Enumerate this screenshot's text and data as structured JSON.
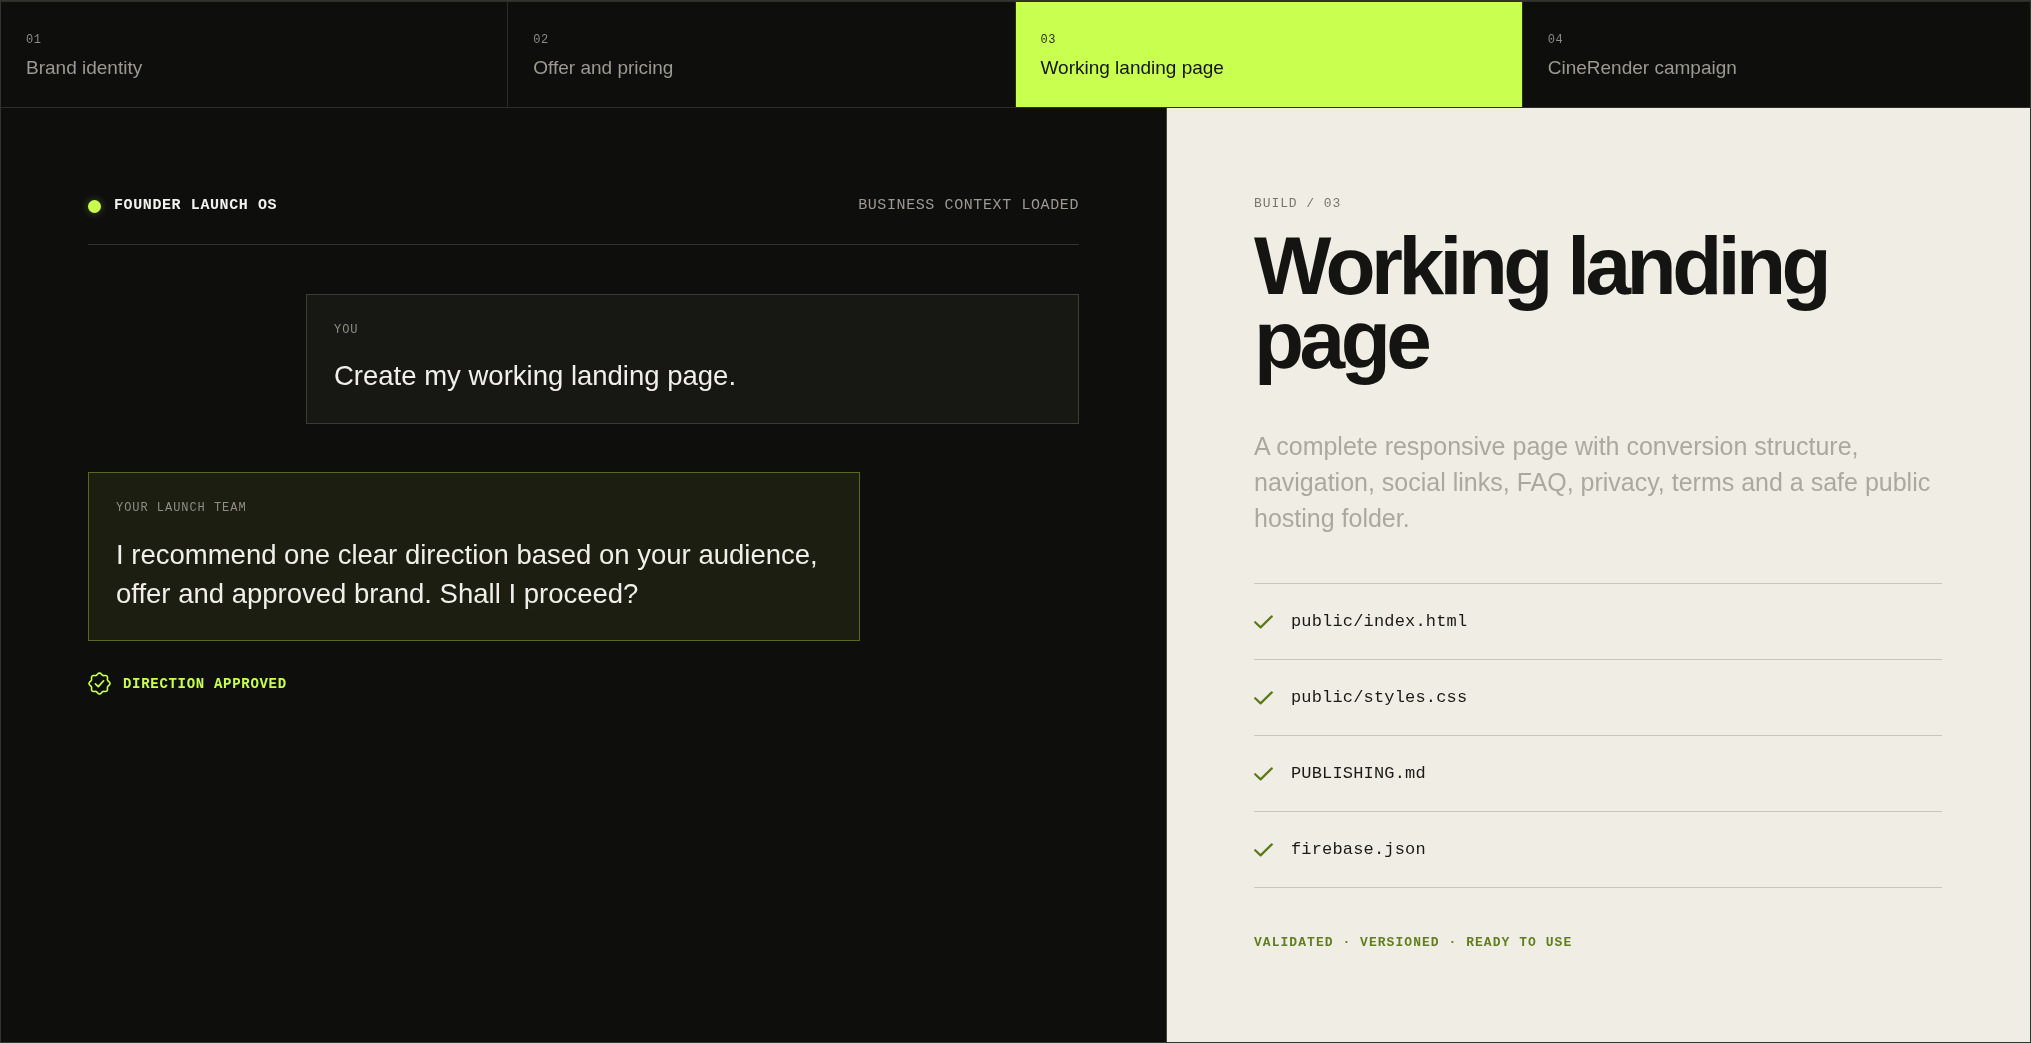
{
  "tabs": [
    {
      "number": "01",
      "label": "Brand identity",
      "selected": false
    },
    {
      "number": "02",
      "label": "Offer and pricing",
      "selected": false
    },
    {
      "number": "03",
      "label": "Working landing page",
      "selected": true
    },
    {
      "number": "04",
      "label": "CineRender campaign",
      "selected": false
    }
  ],
  "chat_panel": {
    "header": {
      "title": "FOUNDER LAUNCH OS",
      "status": "BUSINESS CONTEXT LOADED"
    },
    "messages": [
      {
        "kind": "user",
        "sender": "YOU",
        "text": "Create my working landing page."
      },
      {
        "kind": "assistant",
        "sender": "YOUR LAUNCH TEAM",
        "text": "I recommend one clear direction based on your audience, offer and approved brand. Shall I proceed?"
      }
    ],
    "approval": {
      "label": "DIRECTION APPROVED"
    }
  },
  "build_panel": {
    "eyebrow": "BUILD / 03",
    "title": "Working landing page",
    "description": "A complete responsive page with conversion structure, navigation, social links, FAQ, privacy, terms and a safe public hosting folder.",
    "files": [
      {
        "name": "public/index.html",
        "checked": true
      },
      {
        "name": "public/styles.css",
        "checked": true
      },
      {
        "name": "PUBLISHING.md",
        "checked": true
      },
      {
        "name": "firebase.json",
        "checked": true
      }
    ],
    "footer": "VALIDATED · VERSIONED · READY TO USE"
  }
}
